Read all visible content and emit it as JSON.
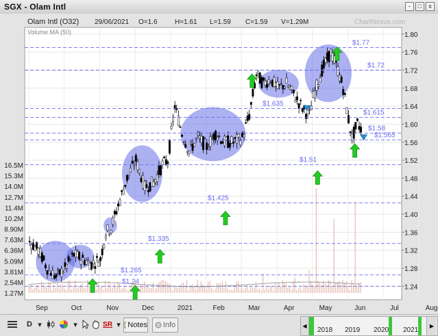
{
  "window": {
    "title": "SGX - Olam Intl",
    "controls": {
      "minimize": "-",
      "maximize": "□",
      "close": "x"
    }
  },
  "chart_header": {
    "name": "Olam Intl (O32)",
    "date": "29/06/2021",
    "open": "O=1.6",
    "high": "H=1.61",
    "low": "L=1.59",
    "close": "C=1.59",
    "volume": "V=1.29M",
    "watermark": "ChartNexus.com",
    "indicator": "Volume MA (50)"
  },
  "colors": {
    "up_candle": "#ffffff",
    "down_candle": "#000000",
    "circle": "#5a64e6",
    "arrow": "#22cc22",
    "level_line": "#6b6bf0",
    "volume_bar": "#e0b0a0",
    "marker": "#2b8fd8"
  },
  "chart_data": {
    "type": "candlestick",
    "x_tick_labels": [
      "Sep",
      "Oct",
      "Nov",
      "Dec",
      "2021",
      "Feb",
      "Mar",
      "Apr",
      "May",
      "Jun",
      "Jul",
      "Aug"
    ],
    "y_ticks": [
      1.24,
      1.28,
      1.32,
      1.36,
      1.4,
      1.44,
      1.48,
      1.52,
      1.56,
      1.6,
      1.64,
      1.68,
      1.72,
      1.76,
      1.8
    ],
    "y_tick_labels": [
      "1.24",
      "1.28",
      "1.32",
      "1.36",
      "1.40",
      "1.44",
      "1.48",
      "1.52",
      "1.56",
      "1.60",
      "1.64",
      "1.68",
      "1.72",
      "1.76",
      "1.80"
    ],
    "ylim": [
      1.21,
      1.815
    ],
    "volume_ticks": [
      "16.5M",
      "15.3M",
      "14.0M",
      "12.7M",
      "11.4M",
      "10.2M",
      "8.90M",
      "7.63M",
      "6.36M",
      "5.09M",
      "3.81M",
      "2.54M",
      "1.27M"
    ],
    "volume_max": 16.5,
    "levels": [
      {
        "value": 1.77,
        "label": "$1.77"
      },
      {
        "value": 1.72,
        "label": "$1.72"
      },
      {
        "value": 1.635,
        "label": "$1.635"
      },
      {
        "value": 1.615,
        "label": "$1.615"
      },
      {
        "value": 1.58,
        "label": "$1.58"
      },
      {
        "value": 1.565,
        "label": "$1.565"
      },
      {
        "value": 1.51,
        "label": "$1.51"
      },
      {
        "value": 1.425,
        "label": "$1.425"
      },
      {
        "value": 1.335,
        "label": "$1.335"
      },
      {
        "value": 1.265,
        "label": "$1.265"
      },
      {
        "value": 1.24,
        "label": "$1.24"
      }
    ],
    "price_path": [
      {
        "month": 0,
        "price": 1.34
      },
      {
        "month": 0.25,
        "price": 1.32
      },
      {
        "month": 0.5,
        "price": 1.28
      },
      {
        "month": 0.75,
        "price": 1.26
      },
      {
        "month": 1.0,
        "price": 1.28
      },
      {
        "month": 1.25,
        "price": 1.31
      },
      {
        "month": 1.5,
        "price": 1.3
      },
      {
        "month": 1.75,
        "price": 1.29
      },
      {
        "month": 2.0,
        "price": 1.3
      },
      {
        "month": 2.15,
        "price": 1.36
      },
      {
        "month": 2.3,
        "price": 1.37
      },
      {
        "month": 2.5,
        "price": 1.42
      },
      {
        "month": 2.75,
        "price": 1.48
      },
      {
        "month": 3.0,
        "price": 1.52
      },
      {
        "month": 3.25,
        "price": 1.46
      },
      {
        "month": 3.5,
        "price": 1.47
      },
      {
        "month": 3.75,
        "price": 1.51
      },
      {
        "month": 3.9,
        "price": 1.52
      },
      {
        "month": 4.1,
        "price": 1.64
      },
      {
        "month": 4.3,
        "price": 1.58
      },
      {
        "month": 4.5,
        "price": 1.54
      },
      {
        "month": 4.75,
        "price": 1.57
      },
      {
        "month": 5.0,
        "price": 1.55
      },
      {
        "month": 5.25,
        "price": 1.58
      },
      {
        "month": 5.5,
        "price": 1.56
      },
      {
        "month": 5.75,
        "price": 1.56
      },
      {
        "month": 6.0,
        "price": 1.57
      },
      {
        "month": 6.2,
        "price": 1.62
      },
      {
        "month": 6.4,
        "price": 1.71
      },
      {
        "month": 6.6,
        "price": 1.69
      },
      {
        "month": 6.8,
        "price": 1.7
      },
      {
        "month": 7.0,
        "price": 1.68
      },
      {
        "month": 7.25,
        "price": 1.69
      },
      {
        "month": 7.5,
        "price": 1.66
      },
      {
        "month": 7.75,
        "price": 1.63
      },
      {
        "month": 7.9,
        "price": 1.62
      },
      {
        "month": 8.0,
        "price": 1.66
      },
      {
        "month": 8.25,
        "price": 1.72
      },
      {
        "month": 8.5,
        "price": 1.76
      },
      {
        "month": 8.7,
        "price": 1.72
      },
      {
        "month": 8.85,
        "price": 1.68
      },
      {
        "month": 9.0,
        "price": 1.61
      },
      {
        "month": 9.1,
        "price": 1.57
      },
      {
        "month": 9.25,
        "price": 1.6
      },
      {
        "month": 9.35,
        "price": 1.59
      }
    ],
    "volume_spikes": [
      {
        "month": 6.6,
        "value": 2.5
      },
      {
        "month": 7.5,
        "value": 2.0
      },
      {
        "month": 8.1,
        "value": 13.5
      },
      {
        "month": 8.6,
        "value": 9.5
      },
      {
        "month": 9.2,
        "value": 11.7
      },
      {
        "month": 7.9,
        "value": 3.0
      }
    ],
    "circles": [
      {
        "month": 0.75,
        "price": 1.295,
        "month_r": 0.55,
        "price_r": 0.046
      },
      {
        "month": 1.45,
        "price": 1.306,
        "month_r": 0.39,
        "price_r": 0.026
      },
      {
        "month": 2.3,
        "price": 1.375,
        "month_r": 0.19,
        "price_r": 0.018
      },
      {
        "month": 3.2,
        "price": 1.49,
        "month_r": 0.57,
        "price_r": 0.063
      },
      {
        "month": 5.2,
        "price": 1.578,
        "month_r": 0.92,
        "price_r": 0.06
      },
      {
        "month": 7.05,
        "price": 1.69,
        "month_r": 0.57,
        "price_r": 0.031
      },
      {
        "month": 8.45,
        "price": 1.713,
        "month_r": 0.66,
        "price_r": 0.064
      }
    ],
    "arrows": [
      {
        "month": 1.8,
        "price": 1.24
      },
      {
        "month": 3.0,
        "price": 1.225
      },
      {
        "month": 3.7,
        "price": 1.305
      },
      {
        "month": 5.55,
        "price": 1.39
      },
      {
        "month": 6.3,
        "price": 1.695
      },
      {
        "month": 8.15,
        "price": 1.48
      },
      {
        "month": 8.7,
        "price": 1.755
      },
      {
        "month": 9.2,
        "price": 1.54
      }
    ],
    "markers": [
      {
        "month": 7.85,
        "price": 1.637
      },
      {
        "month": 9.45,
        "price": 1.572
      }
    ]
  },
  "toolbar": {
    "notes_label": "Notes",
    "info_label": "Info",
    "period_label": "D",
    "sr_label": "SR",
    "years": [
      "2018",
      "2019",
      "2020",
      "2021"
    ],
    "highlighted_year": "2021"
  }
}
